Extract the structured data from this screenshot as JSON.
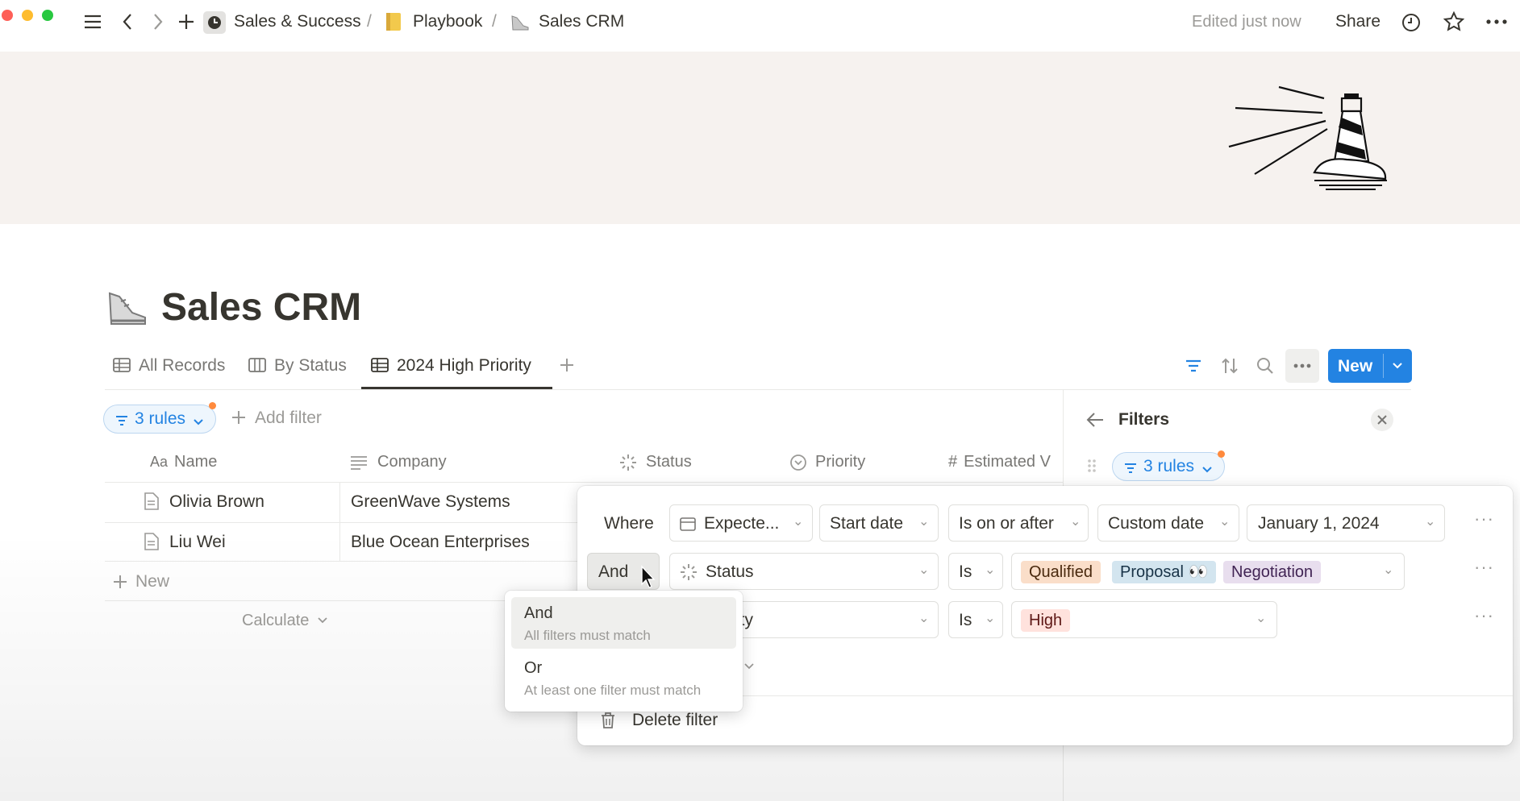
{
  "topbar": {
    "breadcrumb": [
      "Sales & Success",
      "Playbook",
      "Sales CRM"
    ],
    "edited": "Edited just now",
    "share": "Share"
  },
  "page": {
    "title": "Sales CRM"
  },
  "views": {
    "tabs": [
      "All Records",
      "By Status",
      "2024 High Priority"
    ],
    "new_label": "New"
  },
  "filterbar": {
    "rules_label": "3 rules",
    "add_filter": "Add filter"
  },
  "table": {
    "columns": [
      "Name",
      "Company",
      "Status",
      "Priority",
      "Estimated V"
    ],
    "rows": [
      {
        "name": "Olivia Brown",
        "company": "GreenWave Systems"
      },
      {
        "name": "Liu Wei",
        "company": "Blue Ocean Enterprises"
      }
    ],
    "new_row": "New",
    "calculate": "Calculate"
  },
  "filters_panel": {
    "title": "Filters",
    "rules_label": "3 rules"
  },
  "filter_rules": {
    "row1": {
      "connector": "Where",
      "property": "Expecte...",
      "subproperty": "Start date",
      "operator": "Is on or after",
      "date_mode": "Custom date",
      "value": "January 1, 2024"
    },
    "row2": {
      "connector": "And",
      "property": "Status",
      "operator": "Is",
      "tags": [
        "Qualified",
        "Proposal 👀",
        "Negotiation"
      ]
    },
    "row3": {
      "property_fragment": "ity",
      "operator": "Is",
      "tags": [
        "High"
      ]
    },
    "delete": "Delete filter"
  },
  "connector_menu": {
    "options": [
      {
        "title": "And",
        "desc": "All filters must match"
      },
      {
        "title": "Or",
        "desc": "At least one filter must match"
      }
    ]
  },
  "colors": {
    "accent": "#2383e2",
    "tag_qualified": "#fadec9",
    "tag_proposal": "#d3e5ef",
    "tag_negotiation": "#e8deee",
    "tag_high": "#ffe2dd"
  }
}
